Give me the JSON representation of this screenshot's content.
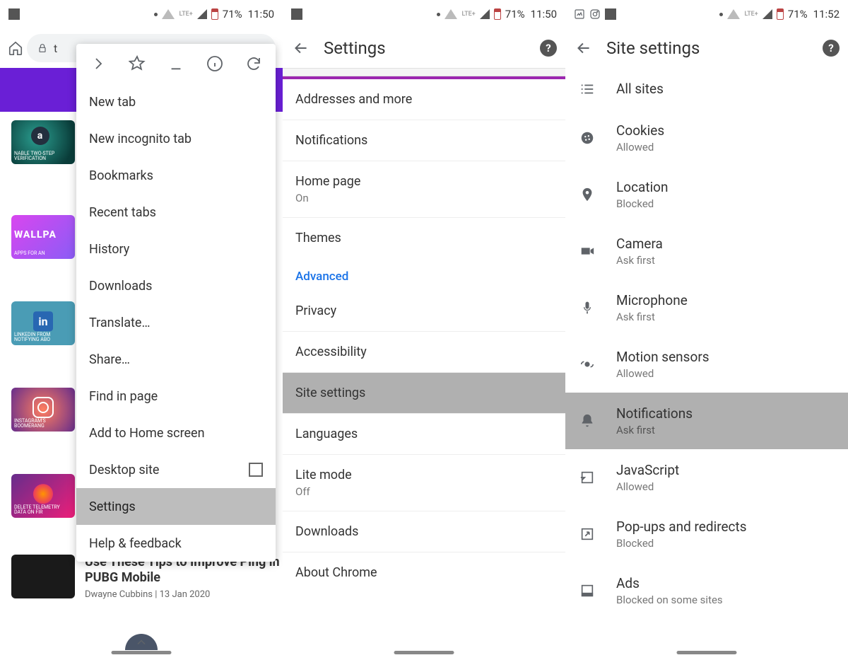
{
  "status": {
    "lte": "LTE+",
    "battery": "71%",
    "time1": "11:50",
    "time2": "11:50",
    "time3": "11:52"
  },
  "screen1": {
    "url_prefix": "t",
    "banner_thumbs": [
      {
        "caption": "NABLE TWO-STEP VERIFICATION"
      },
      {
        "title": "WALLPA",
        "subtitle": "APPS FOR AN"
      },
      {
        "caption": "LINKEDIN FROM NOTIFYING ABO"
      },
      {
        "caption": "INSTAGRAM'S BOOMERANG"
      },
      {
        "caption": "DELETE TELEMETRY DATA ON FIR"
      }
    ],
    "article": {
      "title": "Use These Tips to Improve Ping in PUBG Mobile",
      "byline": "Dwayne Cubbins | 13 Jan 2020"
    },
    "menu": {
      "items": [
        "New tab",
        "New incognito tab",
        "Bookmarks",
        "Recent tabs",
        "History",
        "Downloads",
        "Translate…",
        "Share…",
        "Find in page",
        "Add to Home screen",
        "Desktop site",
        "Settings",
        "Help & feedback"
      ]
    }
  },
  "screen2": {
    "title": "Settings",
    "items": [
      {
        "label": "Addresses and more"
      },
      {
        "label": "Notifications"
      },
      {
        "label": "Home page",
        "sub": "On"
      },
      {
        "label": "Themes"
      }
    ],
    "section": "Advanced",
    "advanced_items": [
      {
        "label": "Privacy"
      },
      {
        "label": "Accessibility"
      },
      {
        "label": "Site settings",
        "highlight": true
      },
      {
        "label": "Languages"
      },
      {
        "label": "Lite mode",
        "sub": "Off"
      },
      {
        "label": "Downloads"
      },
      {
        "label": "About Chrome"
      }
    ]
  },
  "screen3": {
    "title": "Site settings",
    "items": [
      {
        "icon": "list",
        "label": "All sites"
      },
      {
        "icon": "cookie",
        "label": "Cookies",
        "sub": "Allowed"
      },
      {
        "icon": "pin",
        "label": "Location",
        "sub": "Blocked"
      },
      {
        "icon": "camera",
        "label": "Camera",
        "sub": "Ask first"
      },
      {
        "icon": "mic",
        "label": "Microphone",
        "sub": "Ask first"
      },
      {
        "icon": "motion",
        "label": "Motion sensors",
        "sub": "Allowed"
      },
      {
        "icon": "bell",
        "label": "Notifications",
        "sub": "Ask first",
        "highlight": true
      },
      {
        "icon": "js",
        "label": "JavaScript",
        "sub": "Allowed"
      },
      {
        "icon": "popup",
        "label": "Pop-ups and redirects",
        "sub": "Blocked"
      },
      {
        "icon": "ads",
        "label": "Ads",
        "sub": "Blocked on some sites"
      }
    ]
  }
}
